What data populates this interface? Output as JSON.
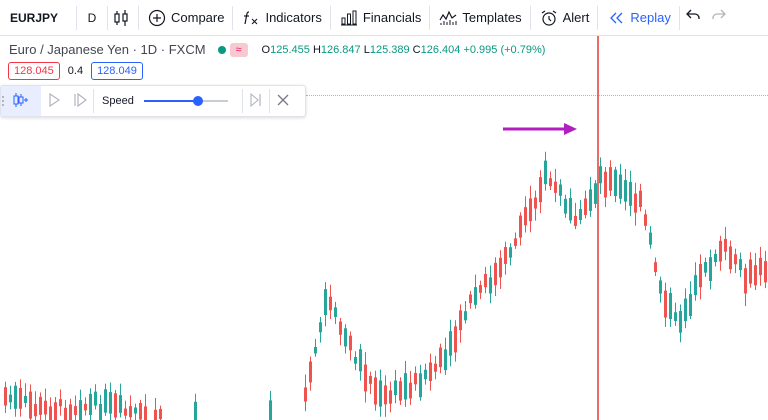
{
  "toolbar": {
    "symbol": "EURJPY",
    "interval": "D",
    "compare_label": "Compare",
    "indicators_label": "Indicators",
    "financials_label": "Financials",
    "templates_label": "Templates",
    "alert_label": "Alert",
    "replay_label": "Replay"
  },
  "legend": {
    "title": "Euro / Japanese Yen · 1D · FXCM",
    "toggle_icon": "wave-icon",
    "ohlc": {
      "o_label": "O",
      "o": "125.455",
      "h_label": "H",
      "h": "126.847",
      "l_label": "L",
      "l": "125.389",
      "c_label": "C",
      "c": "126.404",
      "change": "+0.995 (+0.79%)"
    }
  },
  "prices": {
    "bid": "128.045",
    "spread": "0.4",
    "ask": "128.049"
  },
  "replay_bar": {
    "speed_label": "Speed",
    "speed_value": 0.65
  },
  "colors": {
    "up": "#26a69a",
    "down": "#ef5350",
    "accent": "#2962ff",
    "replay_line": "#e53935",
    "annotation_arrow": "#b11fc0"
  },
  "chart_data": {
    "type": "candlestick",
    "instrument": "EURJPY",
    "timeframe": "1D",
    "last_close": 126.404
  }
}
